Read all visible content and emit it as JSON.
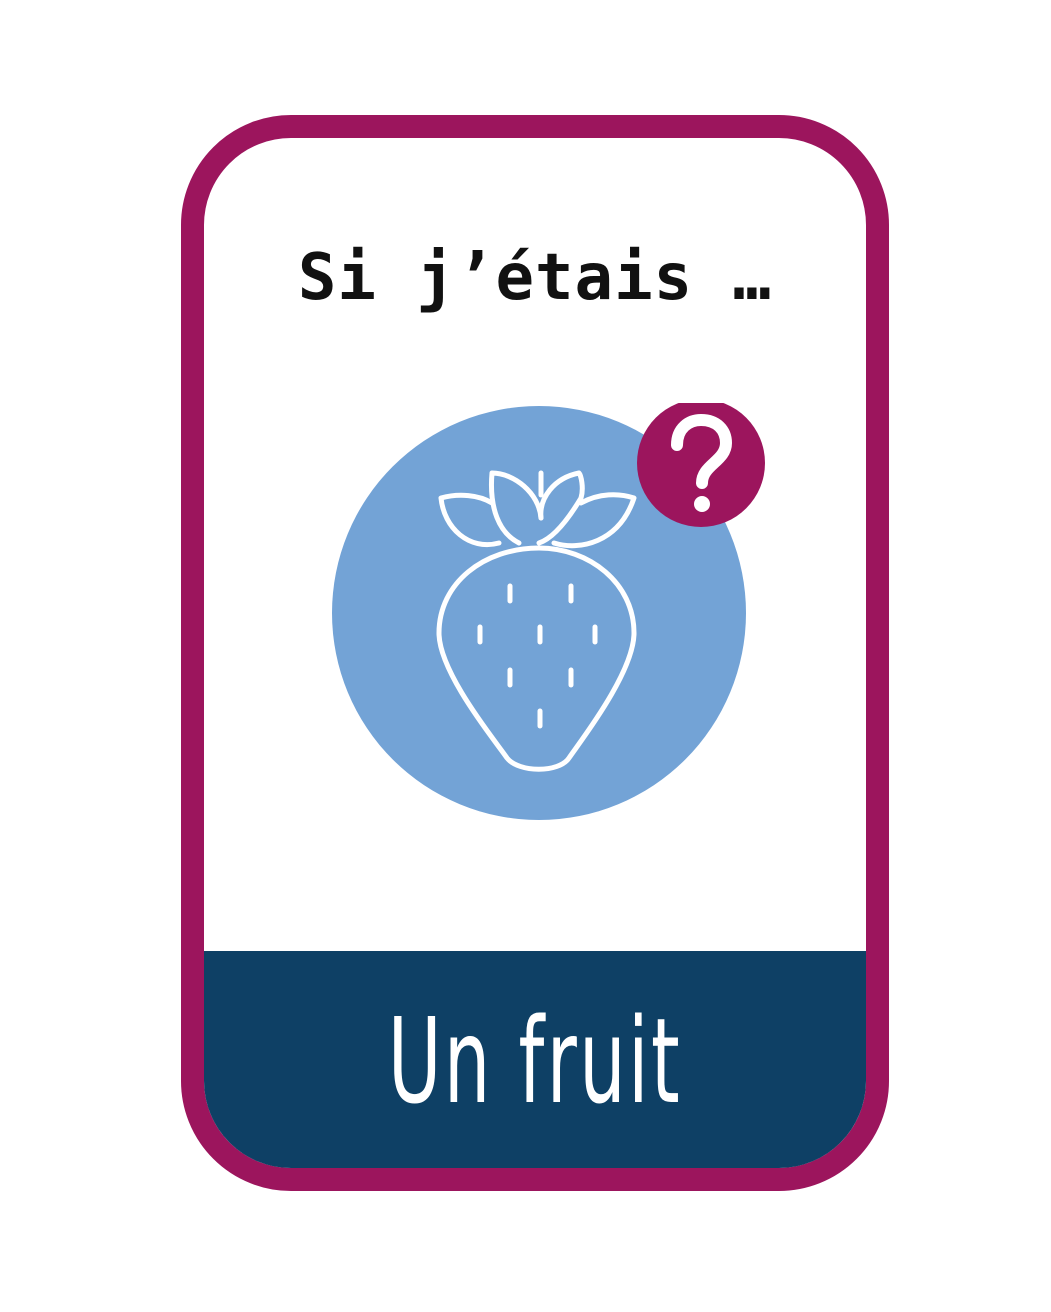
{
  "card": {
    "title": "Si j’étais …",
    "caption": "Un fruit"
  },
  "icons": {
    "main": "strawberry-icon",
    "badge": "question-mark-icon"
  },
  "colors": {
    "border": "#9c155d",
    "circle": "#73a3d6",
    "band": "#0e4065",
    "badge": "#9c155d",
    "icon_stroke": "#ffffff"
  }
}
